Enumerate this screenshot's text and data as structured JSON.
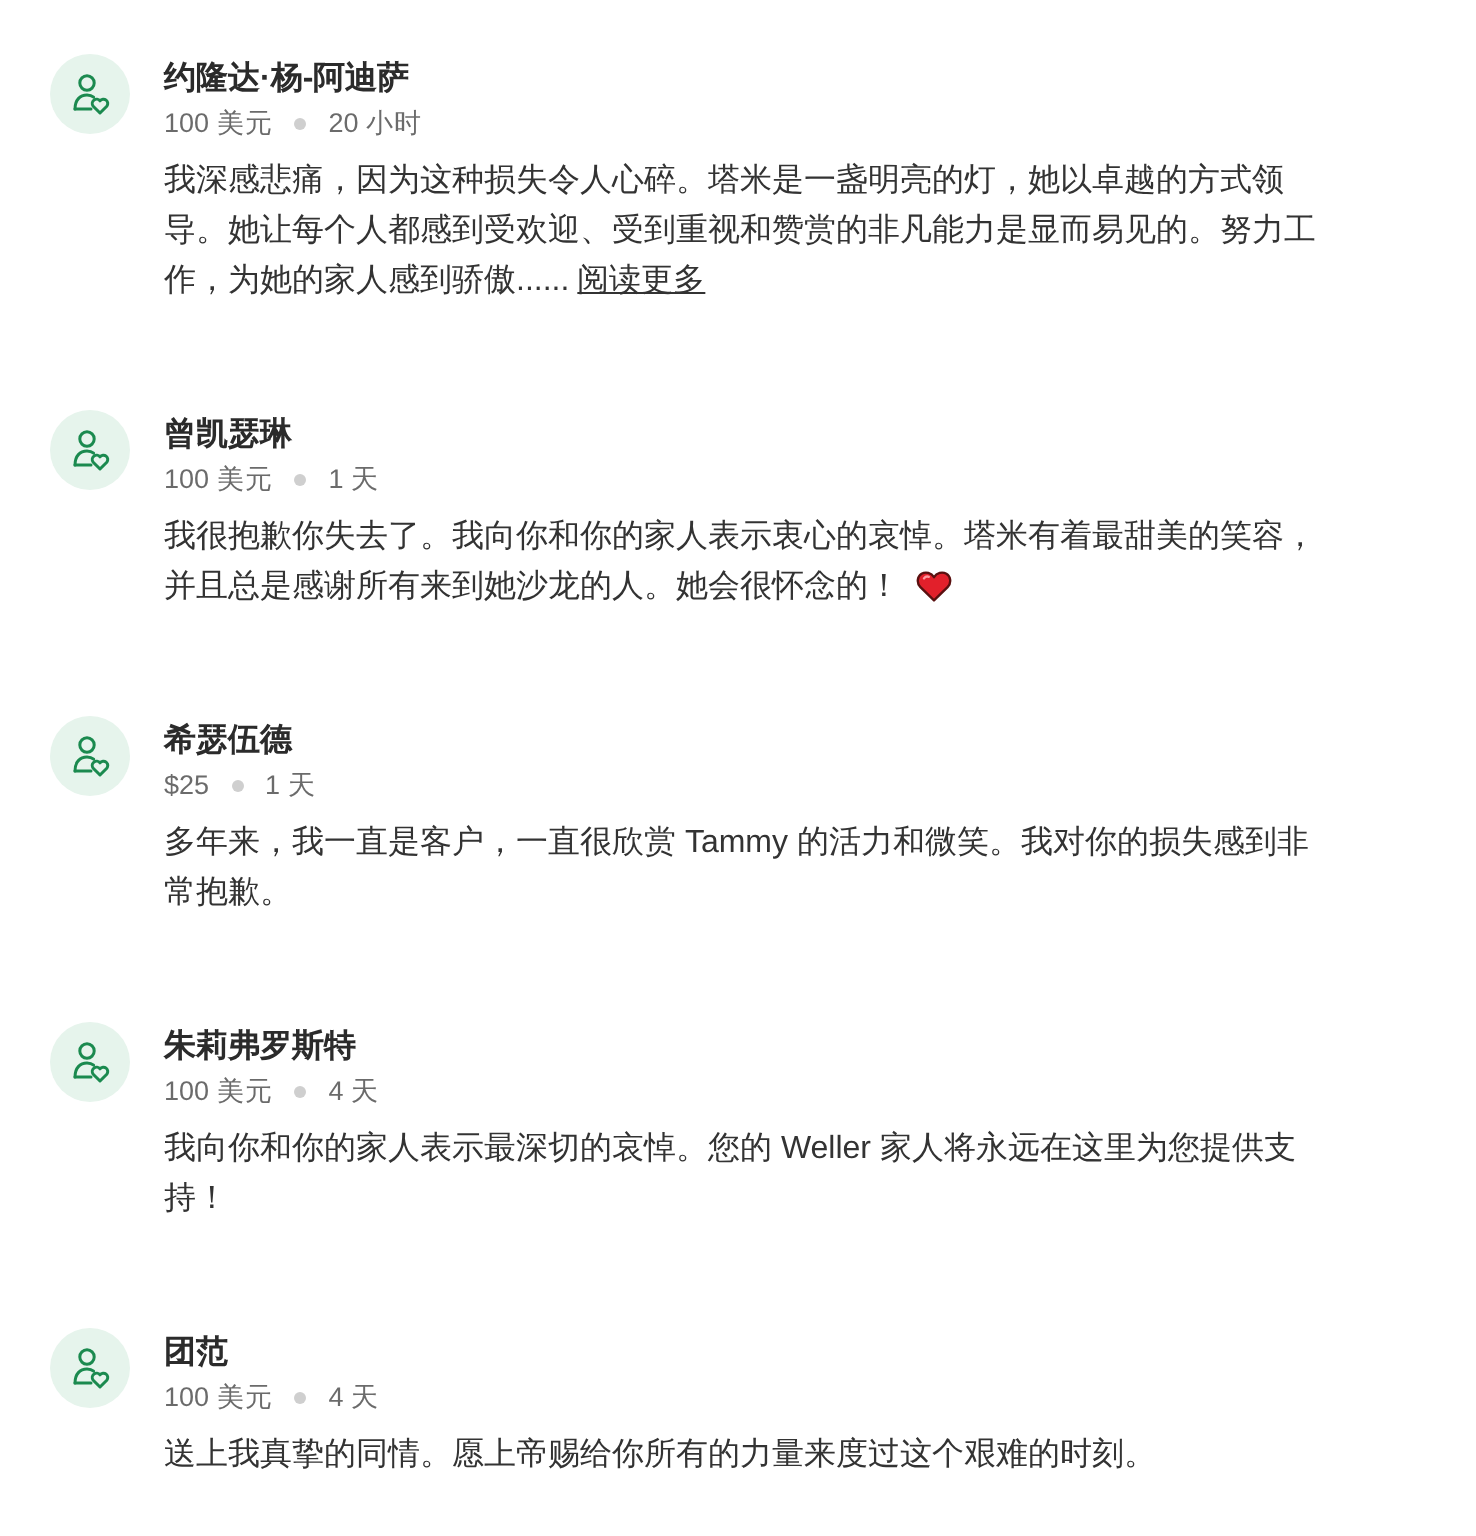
{
  "comments": [
    {
      "name": "约隆达·杨-阿迪萨",
      "amount": "100 美元",
      "time": "20 小时",
      "text": "我深感悲痛，因为这种损失令人心碎。塔米是一盏明亮的灯，她以卓越的方式领导。她让每个人都感到受欢迎、受到重视和赞赏的非凡能力是显而易见的。努力工作，为她的家人感到骄傲......",
      "read_more": "阅读更多",
      "heart": false
    },
    {
      "name": "曾凯瑟琳",
      "amount": "100 美元",
      "time": "1 天",
      "text": "我很抱歉你失去了。我向你和你的家人表示衷心的哀悼。塔米有着最甜美的笑容，并且总是感谢所有来到她沙龙的人。她会很怀念的！",
      "heart": true
    },
    {
      "name": "希瑟伍德",
      "amount": "$25",
      "time": "1 天",
      "text": "多年来，我一直是客户，一直很欣赏 Tammy 的活力和微笑。我对你的损失感到非常抱歉。",
      "heart": false
    },
    {
      "name": "朱莉弗罗斯特",
      "amount": "100 美元",
      "time": "4 天",
      "text": "我向你和你的家人表示最深切的哀悼。您的 Weller 家人将永远在这里为您提供支持！",
      "heart": false
    },
    {
      "name": "团范",
      "amount": "100 美元",
      "time": "4 天",
      "text": "送上我真挚的同情。愿上帝赐给你所有的力量来度过这个艰难的时刻。",
      "heart": false
    }
  ]
}
